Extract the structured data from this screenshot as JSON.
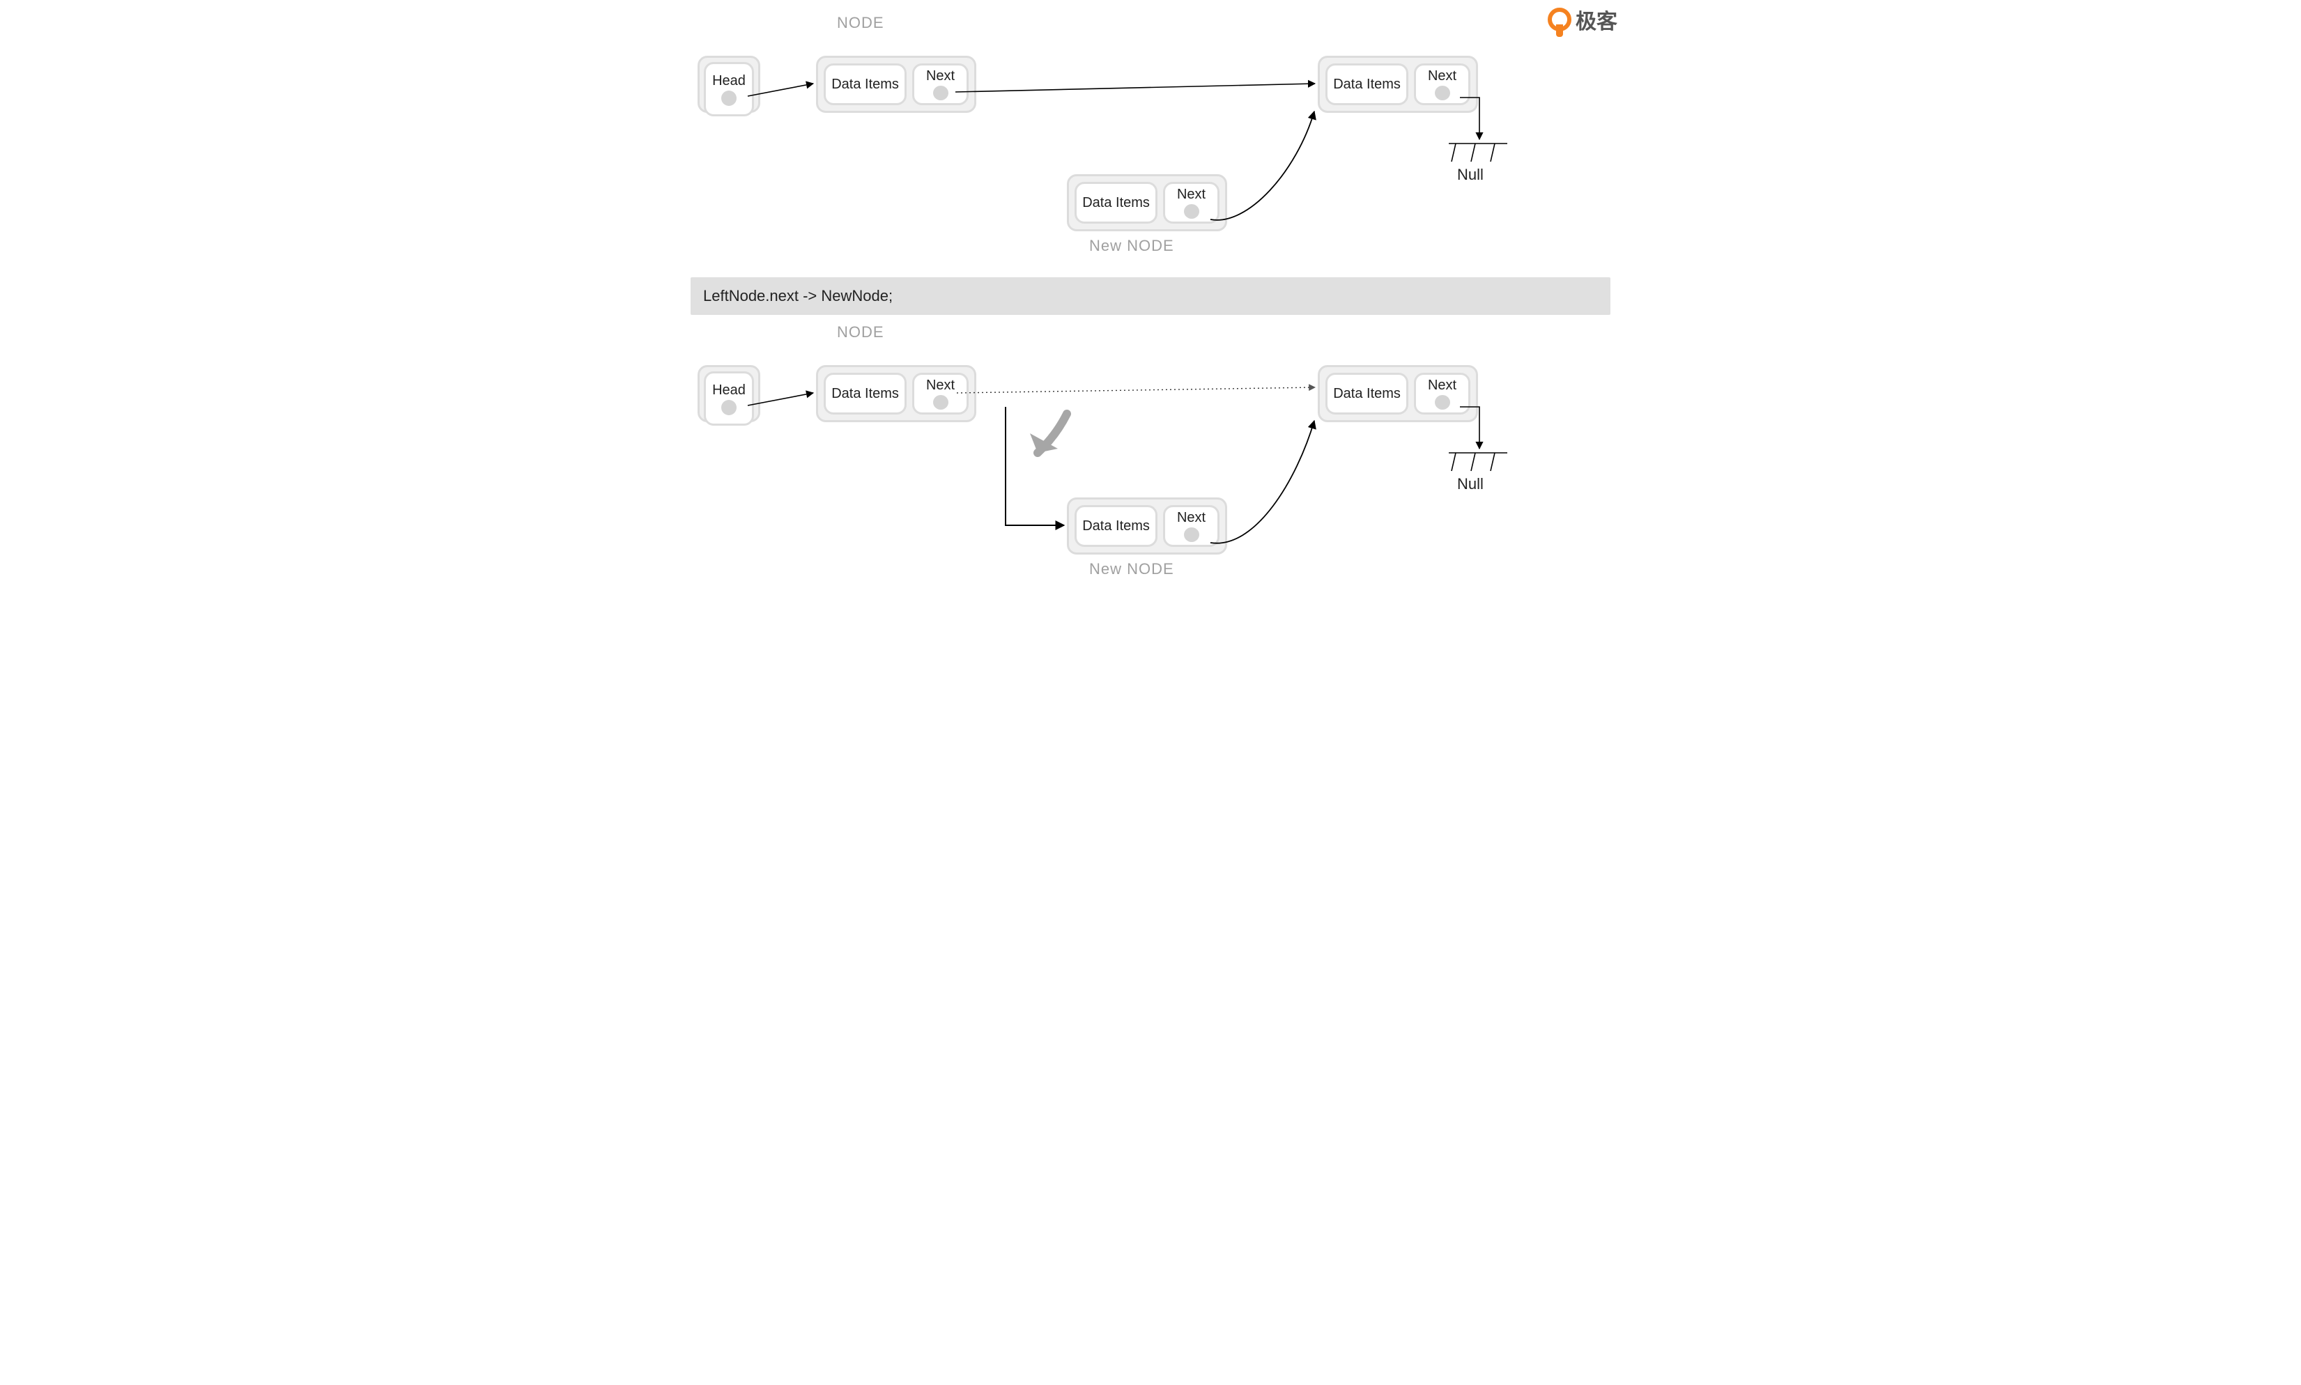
{
  "watermark": "极客",
  "labels": {
    "node": "NODE",
    "newnode": "New NODE",
    "head": "Head",
    "data": "Data Items",
    "next": "Next",
    "null": "Null"
  },
  "codeline": "LeftNode.next  ->  NewNode;",
  "diagrams": {
    "top": {
      "description": "New node's next already points to right node (curved). Left node's next still points straight to right node.",
      "arrows": [
        {
          "from": "head",
          "to": "leftNode",
          "style": "straight"
        },
        {
          "from": "leftNode.next",
          "to": "rightNode",
          "style": "straight"
        },
        {
          "from": "newNode.next",
          "to": "rightNode",
          "style": "curved-up"
        },
        {
          "from": "rightNode.next",
          "to": "null",
          "style": "down-ground"
        }
      ]
    },
    "bottom": {
      "description": "After LeftNode.next -> NewNode: left node's next now goes down to new node (solid). Former link to right node shown dotted. New node still points to right node.",
      "arrows": [
        {
          "from": "head",
          "to": "leftNode",
          "style": "straight"
        },
        {
          "from": "leftNode.next",
          "to": "rightNode",
          "style": "dotted-straight"
        },
        {
          "from": "leftNode.next",
          "to": "newNode",
          "style": "down-right-solid"
        },
        {
          "from": "newNode.next",
          "to": "rightNode",
          "style": "curved-up"
        },
        {
          "from": "rightNode.next",
          "to": "null",
          "style": "down-ground"
        }
      ],
      "highlight_arrow": "large gray curved arrow indicating the re-link"
    }
  }
}
